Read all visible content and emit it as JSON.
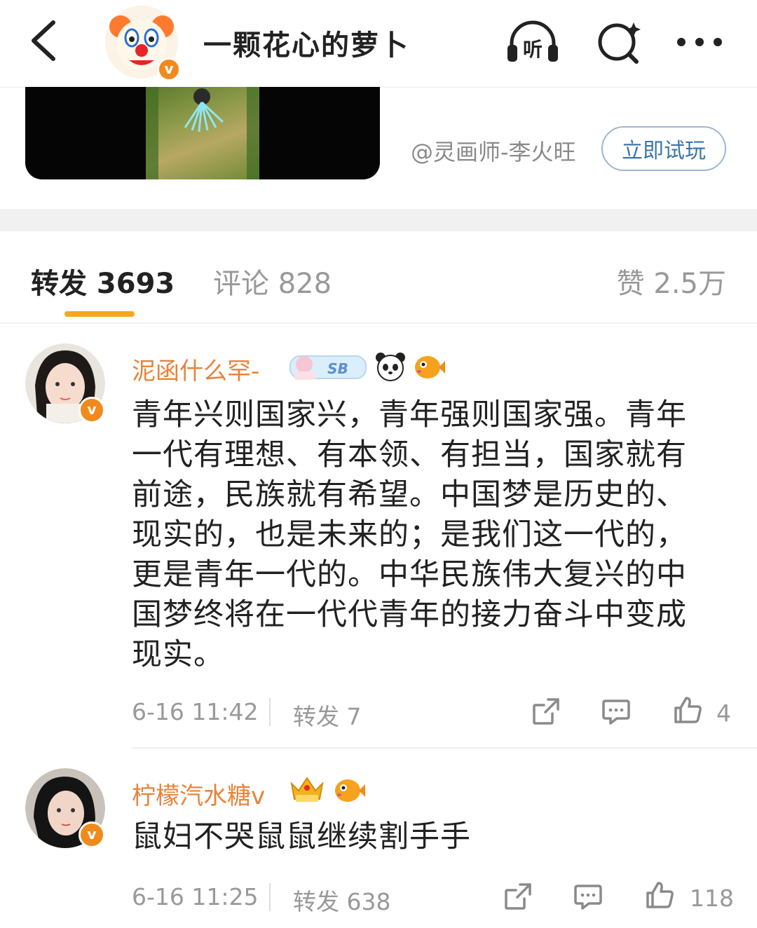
{
  "header": {
    "title": "一颗花心的萝卜",
    "listen_label": "听"
  },
  "card": {
    "author": "@灵画师-李火旺",
    "try_button": "立即试玩"
  },
  "tabs": {
    "repost": "转发 3693",
    "comment": "评论 828",
    "like": "赞 2.5万"
  },
  "comments": [
    {
      "username": "泥函什么罕-",
      "badge_text": "SB",
      "text": "青年兴则国家兴，青年强则国家强。青年一代有理想、有本领、有担当，国家就有前途，民族就有希望。中国梦是历史的、现实的，也是未来的；是我们这一代的，更是青年一代的。中华民族伟大复兴的中国梦终将在一代代青年的接力奋斗中变成现实。",
      "time": "6-16 11:42",
      "repost": "转发 7",
      "likes": "4"
    },
    {
      "username": "柠檬汽水糖v",
      "text": "鼠妇不哭鼠鼠继续割手手",
      "time": "6-16 11:25",
      "repost": "转发 638",
      "likes": "118"
    }
  ],
  "colors": {
    "accent": "#f5a623",
    "username": "#e8833a",
    "verified": "#f08a1d",
    "link": "#3c76a8"
  }
}
